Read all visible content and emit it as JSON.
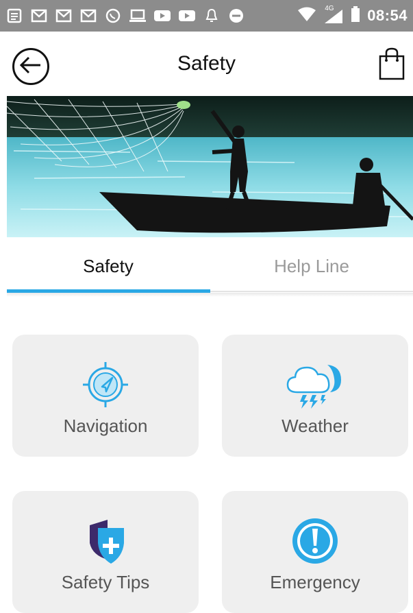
{
  "status_bar": {
    "time": "08:54",
    "network": "4G",
    "icons": [
      "notes-icon",
      "gmail-icon",
      "gmail-icon",
      "gmail-icon",
      "whatsapp-icon",
      "laptop-icon",
      "youtube-icon",
      "youtube-icon",
      "bell-icon",
      "do-not-disturb-icon",
      "wifi-icon",
      "signal-icon",
      "battery-icon"
    ]
  },
  "header": {
    "title": "Safety",
    "back_icon": "back-arrow-icon",
    "cart_icon": "shopping-bag-icon"
  },
  "tabs": [
    {
      "label": "Safety",
      "active": true
    },
    {
      "label": "Help Line",
      "active": false
    }
  ],
  "cards": [
    {
      "label": "Navigation",
      "icon": "compass-icon"
    },
    {
      "label": "Weather",
      "icon": "storm-cloud-icon"
    },
    {
      "label": "Safety Tips",
      "icon": "shield-plus-icon"
    },
    {
      "label": "Emergency",
      "icon": "exclamation-icon"
    }
  ],
  "colors": {
    "accent": "#2aa8e5",
    "status_bar": "#8c8c8c",
    "card_bg": "#efefef",
    "shield_dark": "#3d2a6b"
  }
}
